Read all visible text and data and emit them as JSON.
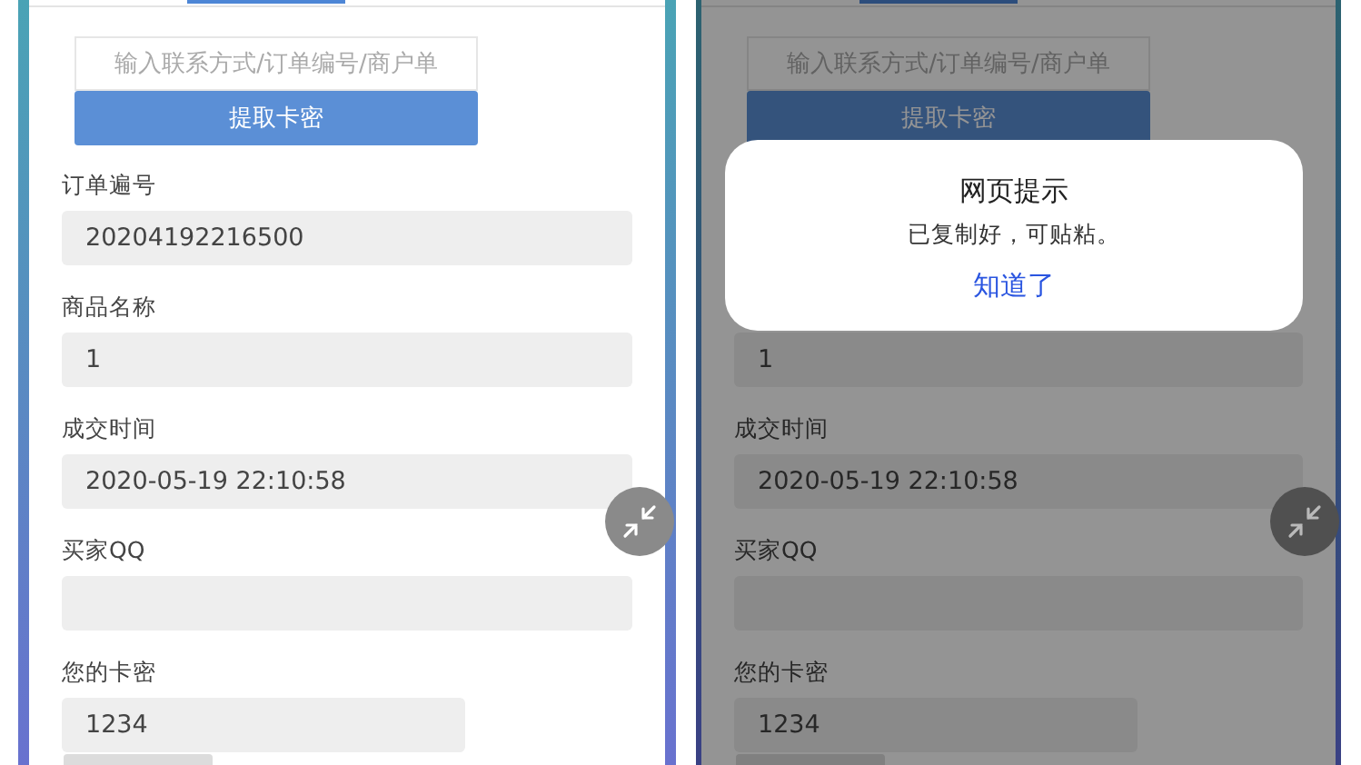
{
  "screens": [
    {
      "dimmed": false,
      "search": {
        "placeholder": "输入联系方式/订单编号/商户单"
      },
      "submit_button": "提取卡密",
      "fields": [
        {
          "kind": "field",
          "label": "订单遍号",
          "value": "20204192216500"
        },
        {
          "kind": "field",
          "label": "商品名称",
          "value": "1"
        },
        {
          "kind": "field",
          "label": "成交时间",
          "value": "2020-05-19 22:10:58"
        },
        {
          "kind": "field",
          "label": "买家QQ"
        },
        {
          "kind": "short",
          "label": "您的卡密",
          "value": "1234"
        }
      ]
    },
    {
      "dimmed": true,
      "search": {
        "placeholder": "输入联系方式/订单编号/商户单"
      },
      "submit_button": "提取卡密",
      "fields": [
        {
          "kind": "covered"
        },
        {
          "kind": "value-only",
          "value": "1"
        },
        {
          "kind": "field",
          "label": "成交时间",
          "value": "2020-05-19 22:10:58"
        },
        {
          "kind": "field",
          "label": "买家QQ"
        },
        {
          "kind": "short",
          "label": "您的卡密",
          "value": "1234"
        }
      ],
      "dialog": {
        "title": "网页提示",
        "message": "已复制好，可贴粘。",
        "button": "知道了"
      }
    }
  ]
}
